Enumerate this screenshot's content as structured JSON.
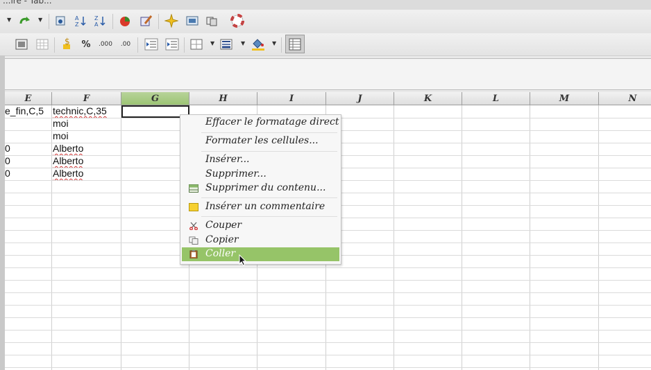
{
  "window": {
    "title_fragment": "...ire - Tab..."
  },
  "columns": [
    {
      "label": "E"
    },
    {
      "label": "F"
    },
    {
      "label": "G"
    },
    {
      "label": "H"
    },
    {
      "label": "I"
    },
    {
      "label": "J"
    },
    {
      "label": "K"
    },
    {
      "label": "L"
    },
    {
      "label": "M"
    },
    {
      "label": "N"
    }
  ],
  "selected_column": "G",
  "cells": {
    "E": [
      "e_fin,C,5",
      "",
      "",
      "0",
      "0",
      "0"
    ],
    "F": [
      "technic,C,35",
      "moi",
      "moi",
      "Alberto",
      "Alberto",
      "Alberto"
    ]
  },
  "toolbar2": {
    "percent": "%",
    "decimal_add": ".000",
    "decimal_remove": ".00"
  },
  "context_menu": {
    "items": [
      {
        "label": "Effacer le formatage direct",
        "icon": "",
        "highlighted": false
      },
      {
        "label": "Formater les cellules...",
        "icon": "",
        "highlighted": false
      },
      {
        "label": "Insérer...",
        "icon": "",
        "highlighted": false
      },
      {
        "label": "Supprimer...",
        "icon": "",
        "highlighted": false
      },
      {
        "label": "Supprimer du contenu...",
        "icon": "delete-contents-icon",
        "highlighted": false
      },
      {
        "label": "Insérer un commentaire",
        "icon": "comment-icon",
        "highlighted": false
      },
      {
        "label": "Couper",
        "icon": "scissors-icon",
        "highlighted": false
      },
      {
        "label": "Copier",
        "icon": "copy-icon",
        "highlighted": false
      },
      {
        "label": "Coller",
        "icon": "paste-icon",
        "highlighted": true
      }
    ]
  },
  "colors": {
    "selection": "#96c468",
    "column_selected": "#a8cb84",
    "spell_error": "#d03030"
  }
}
